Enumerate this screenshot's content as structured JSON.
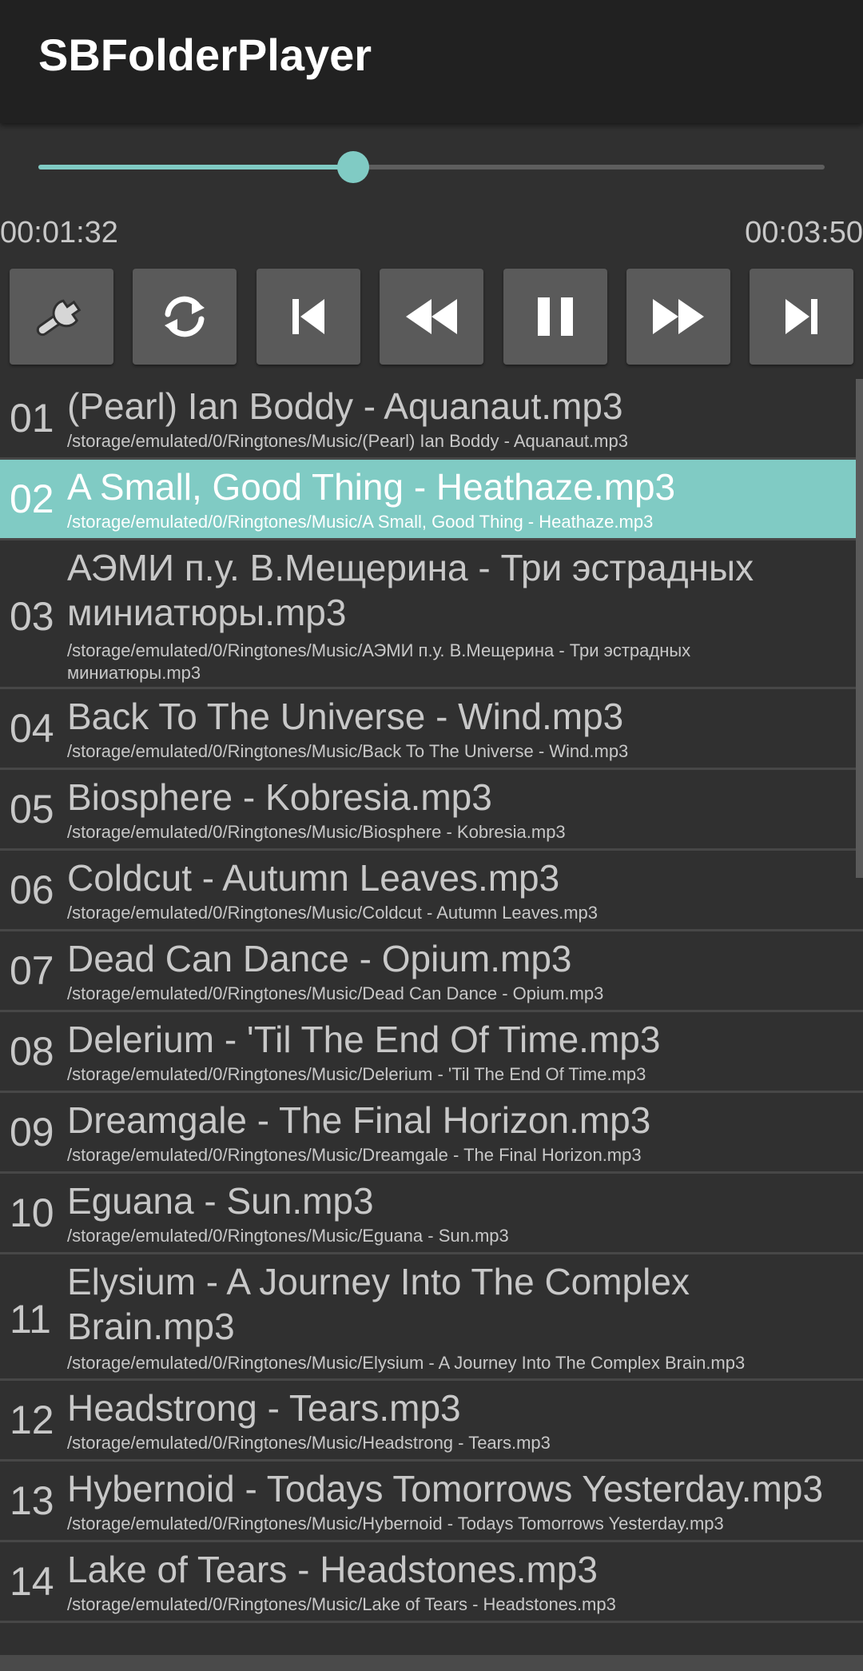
{
  "app": {
    "title": "SBFolderPlayer",
    "accent_color": "#80cbc4",
    "background_color": "#303030",
    "toolbar_color": "#212121"
  },
  "player": {
    "elapsed": "00:01:32",
    "total": "00:03:50",
    "progress_fraction": 0.4
  },
  "controls": [
    {
      "name": "settings-button",
      "icon": "wrench-icon"
    },
    {
      "name": "repeat-button",
      "icon": "repeat-icon"
    },
    {
      "name": "previous-track-button",
      "icon": "skip-previous-icon"
    },
    {
      "name": "rewind-button",
      "icon": "rewind-icon"
    },
    {
      "name": "pause-button",
      "icon": "pause-icon"
    },
    {
      "name": "fast-forward-button",
      "icon": "fast-forward-icon"
    },
    {
      "name": "next-track-button",
      "icon": "skip-next-icon"
    }
  ],
  "tracks": [
    {
      "num": "01",
      "title": "(Pearl) Ian Boddy - Aquanaut.mp3",
      "path": "/storage/emulated/0/Ringtones/Music/(Pearl) Ian Boddy - Aquanaut.mp3"
    },
    {
      "num": "02",
      "title": "A Small, Good Thing - Heathaze.mp3",
      "path": "/storage/emulated/0/Ringtones/Music/A Small, Good Thing - Heathaze.mp3",
      "selected": true
    },
    {
      "num": "03",
      "title": "АЭМИ п.у. В.Мещерина - Три эстрадных миниатюры.mp3",
      "path": "/storage/emulated/0/Ringtones/Music/АЭМИ п.у. В.Мещерина - Три эстрадных миниатюры.mp3"
    },
    {
      "num": "04",
      "title": "Back To The Universe - Wind.mp3",
      "path": "/storage/emulated/0/Ringtones/Music/Back To The Universe - Wind.mp3"
    },
    {
      "num": "05",
      "title": "Biosphere - Kobresia.mp3",
      "path": "/storage/emulated/0/Ringtones/Music/Biosphere - Kobresia.mp3"
    },
    {
      "num": "06",
      "title": "Coldcut - Autumn Leaves.mp3",
      "path": "/storage/emulated/0/Ringtones/Music/Coldcut - Autumn Leaves.mp3"
    },
    {
      "num": "07",
      "title": "Dead Can Dance - Opium.mp3",
      "path": "/storage/emulated/0/Ringtones/Music/Dead Can Dance - Opium.mp3"
    },
    {
      "num": "08",
      "title": "Delerium - 'Til The End Of Time.mp3",
      "path": "/storage/emulated/0/Ringtones/Music/Delerium - 'Til The End Of Time.mp3"
    },
    {
      "num": "09",
      "title": "Dreamgale - The Final Horizon.mp3",
      "path": "/storage/emulated/0/Ringtones/Music/Dreamgale - The Final Horizon.mp3"
    },
    {
      "num": "10",
      "title": "Eguana - Sun.mp3",
      "path": "/storage/emulated/0/Ringtones/Music/Eguana - Sun.mp3"
    },
    {
      "num": "11",
      "title": "Elysium - A Journey Into The Complex Brain.mp3",
      "path": "/storage/emulated/0/Ringtones/Music/Elysium - A Journey Into The Complex Brain.mp3"
    },
    {
      "num": "12",
      "title": "Headstrong - Tears.mp3",
      "path": "/storage/emulated/0/Ringtones/Music/Headstrong - Tears.mp3"
    },
    {
      "num": "13",
      "title": "Hybernoid - Todays Tomorrows Yesterday.mp3",
      "path": "/storage/emulated/0/Ringtones/Music/Hybernoid - Todays Tomorrows Yesterday.mp3"
    },
    {
      "num": "14",
      "title": "Lake of Tears - Headstones.mp3",
      "path": "/storage/emulated/0/Ringtones/Music/Lake of Tears - Headstones.mp3"
    }
  ]
}
